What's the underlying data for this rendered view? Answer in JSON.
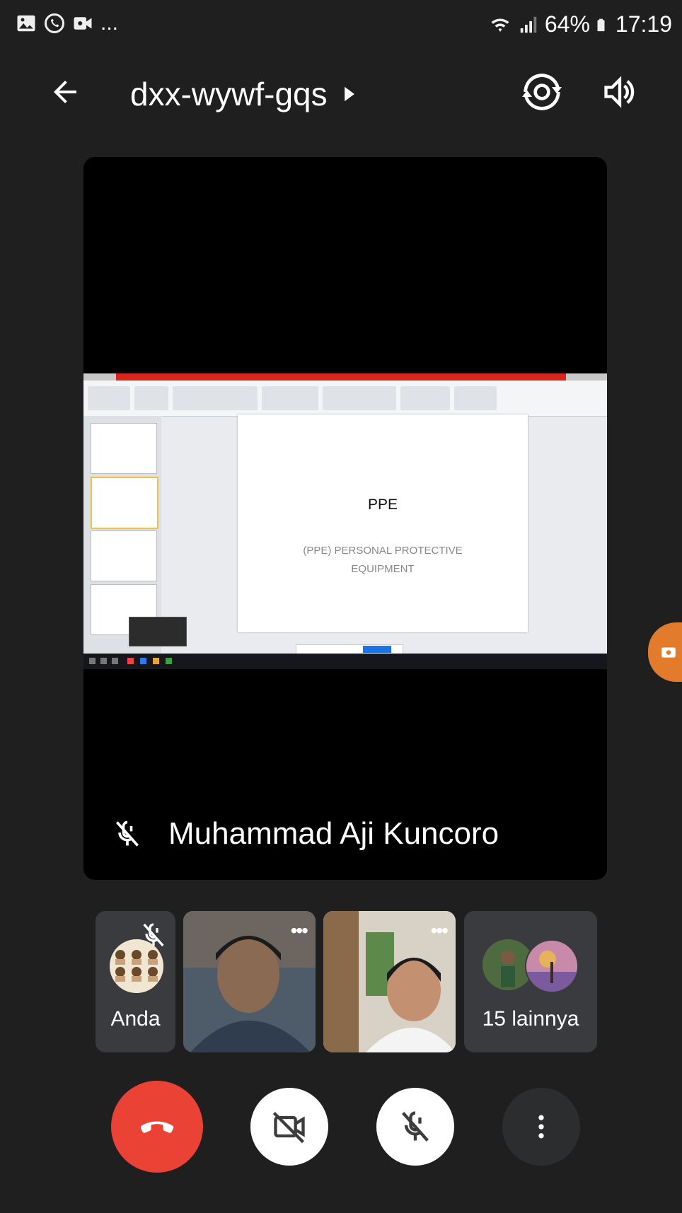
{
  "statusbar": {
    "dots": "...",
    "battery": "64%",
    "time": "17:19"
  },
  "header": {
    "meeting_code": "dxx-wywf-gqs",
    "icons": [
      "back-arrow-icon",
      "play-triangle-icon",
      "switch-camera-icon",
      "speaker-volume-icon"
    ]
  },
  "presentation": {
    "slide_title": "PPE",
    "slide_subtitle": "(PPE) PERSONAL PROTECTIVE EQUIPMENT"
  },
  "speaker": {
    "name": "Muhammad Aji Kuncoro",
    "muted": true
  },
  "participants": {
    "you_label": "Anda",
    "more_label": "15 lainnya",
    "menu_dots": "•••"
  },
  "controls": {
    "icons": [
      "hang-up-icon",
      "camera-off-icon",
      "mic-off-icon",
      "more-vert-icon"
    ],
    "colors": {
      "end_call": "#ea4335",
      "background": "#1f1f1f"
    }
  }
}
